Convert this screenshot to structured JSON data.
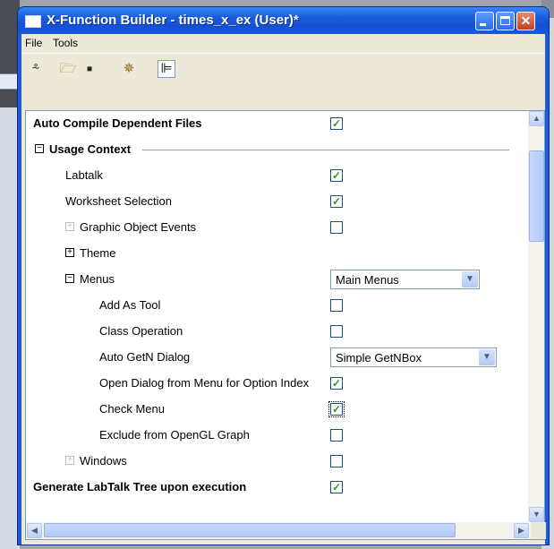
{
  "window": {
    "title": "X-Function Builder - times_x_ex (User)*"
  },
  "menu": {
    "file": "File",
    "tools": "Tools"
  },
  "toolbar": {
    "icons": [
      "wand-icon",
      "open-folder-icon",
      "save-icon",
      "compile-gear-icon",
      "tree-view-icon"
    ],
    "glyphs": {
      "wand": "⸛",
      "open": "🗁",
      "save": "▪",
      "gear": "✵",
      "tree": "⊫"
    }
  },
  "grid": {
    "rows": [
      {
        "label": "Auto Compile Dependent Files",
        "bold": true,
        "checked": true
      },
      {
        "label": "Usage Context",
        "bold": true,
        "expander": "⊟"
      },
      {
        "label": "Labtalk",
        "checked": true
      },
      {
        "label": "Worksheet Selection",
        "checked": true
      },
      {
        "label": "Graphic Object Events",
        "checked": false,
        "expander": "+"
      },
      {
        "label": "Theme",
        "expander": "+"
      },
      {
        "label": "Menus",
        "expander": "−",
        "combo": "Main Menus"
      },
      {
        "label": "Add As Tool",
        "checked": false
      },
      {
        "label": "Class Operation",
        "checked": false
      },
      {
        "label": "Auto GetN Dialog",
        "combo": "Simple GetNBox"
      },
      {
        "label": "Open Dialog from Menu for Option Index",
        "checked": true
      },
      {
        "label": "Check Menu",
        "checked": true
      },
      {
        "label": "Exclude from OpenGL Graph",
        "checked": false
      },
      {
        "label": "Windows",
        "checked": false,
        "expander": "+"
      },
      {
        "label": "Generate LabTalk Tree upon execution",
        "bold": true,
        "checked": true
      }
    ],
    "check_mark": "✓",
    "combo_arrow": "▼"
  },
  "scrollbar": {
    "up": "▲",
    "down": "▼",
    "left": "◀",
    "right": "▶",
    "grip": "≡",
    "hgrip": "|||"
  },
  "colors": {
    "title_blue": "#1f5bd8",
    "check_green": "#21a121",
    "face": "#ece9d8"
  }
}
